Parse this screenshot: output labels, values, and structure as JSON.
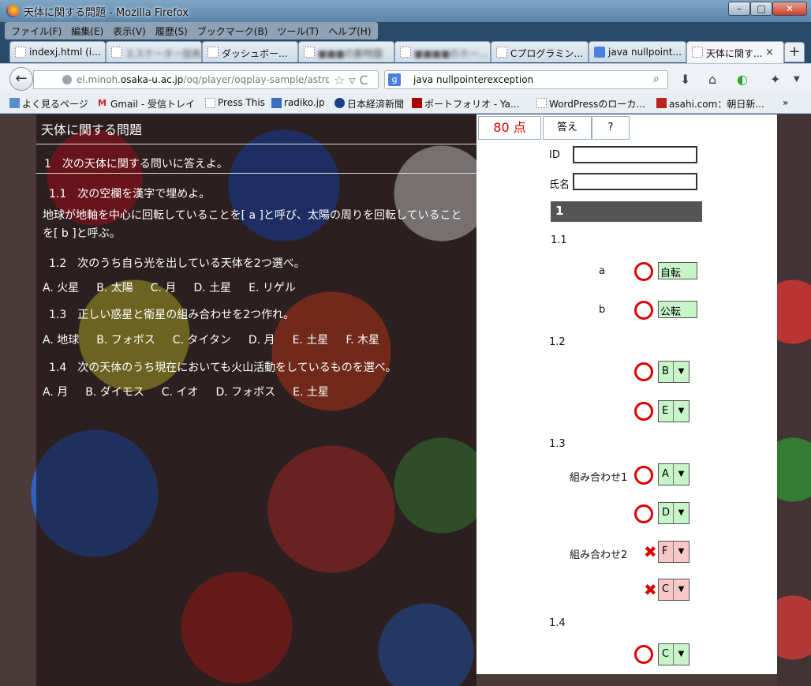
{
  "window": {
    "title": "天体に関する問題 - Mozilla Firefox",
    "min": "–",
    "max": "□",
    "close": "✕"
  },
  "menu": [
    "ファイル(F)",
    "編集(E)",
    "表示(V)",
    "履歴(S)",
    "ブックマーク(B)",
    "ツール(T)",
    "ヘルプ(H)"
  ],
  "tabs": [
    {
      "label": "indexj.html (i..."
    },
    {
      "label": "エスケーター技術..."
    },
    {
      "label": "ダッシュボー..."
    },
    {
      "label": "■■■の動物園"
    },
    {
      "label": "■■■■のホー..."
    },
    {
      "label": "Cプログラミン..."
    },
    {
      "label": "java nullpoint..."
    },
    {
      "label": "天体に関す..."
    }
  ],
  "tab_close": "×",
  "tab_new": "+",
  "nav": {
    "back": "←",
    "url_prefix": "el.minoh.",
    "url_host": "osaka-u.ac.jp",
    "url_rest": "/oq/player/oqplay-sample/astro",
    "search_query": "java nullpointerexception",
    "search_engine": "g"
  },
  "bookmarks": [
    "よく見るページ",
    "Gmail - 受信トレイ",
    "Press This",
    "radiko.jp",
    "日本経済新聞",
    "ポートフォリオ - Ya...",
    "WordPressのローカ...",
    "asahi.com：朝日新..."
  ],
  "bookmarks_more": "»",
  "quiz": {
    "title": "天体に関する問題",
    "q1": "1　次の天体に関する問いに答えよ。",
    "q11": "1.1　次の空欄を漢字で埋めよ。",
    "q11_text": "地球が地軸を中心に回転していることを[ a ]と呼び、太陽の周りを回転していることを[ b ]と呼ぶ。",
    "q12": "1.2　次のうち自ら光を出している天体を2つ選べ。",
    "q12_choices": [
      "A. 火星",
      "B. 太陽",
      "C. 月",
      "D. 土星",
      "E. リゲル"
    ],
    "q13": "1.3　正しい惑星と衛星の組み合わせを2つ作れ。",
    "q13_choices": [
      "A. 地球",
      "B. フォボス",
      "C. タイタン",
      "D. 月",
      "E. 土星",
      "F. 木星"
    ],
    "q14": "1.4　次の天体のうち現在においても火山活動をしているものを選べ。",
    "q14_choices": [
      "A. 月",
      "B. ダイモス",
      "C. イオ",
      "D. フォボス",
      "E. 土星"
    ]
  },
  "panel": {
    "score": "80 点",
    "answer_btn": "答え",
    "help_btn": "?",
    "id_label": "ID",
    "name_label": "氏名",
    "id_value": "",
    "name_value": "",
    "section": "1",
    "s11": "1.1",
    "a_label": "a",
    "a_answer": "自転",
    "b_label": "b",
    "b_answer": "公転",
    "s12": "1.2",
    "s12_a1": "B",
    "s12_a2": "E",
    "s13": "1.3",
    "combo1": "組み合わせ1",
    "combo1_a": "A",
    "combo1_b": "D",
    "combo2": "組み合わせ2",
    "combo2_a": "F",
    "combo2_b": "C",
    "s14": "1.4",
    "s14_a": "C",
    "ng": "✖",
    "dd": "▼"
  }
}
